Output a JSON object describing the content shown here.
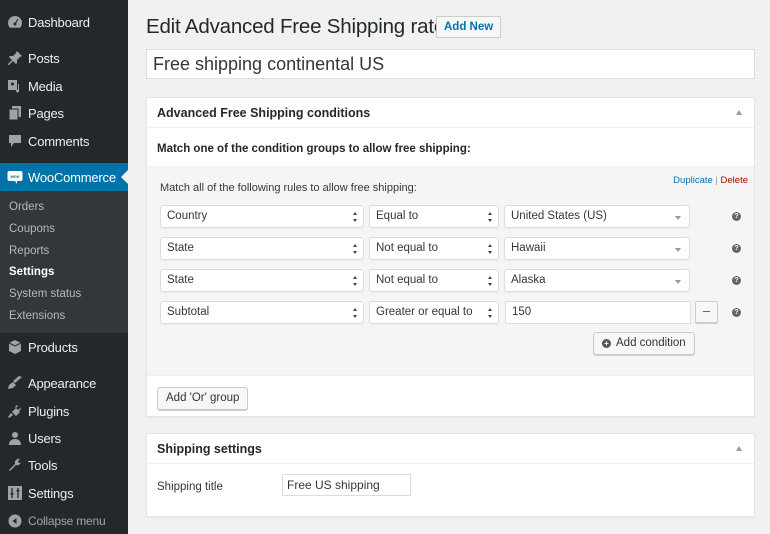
{
  "sidebar": {
    "items": [
      {
        "label": "Dashboard",
        "icon": "dashboard-icon"
      },
      {
        "label": "Posts",
        "icon": "pin-icon"
      },
      {
        "label": "Media",
        "icon": "media-icon"
      },
      {
        "label": "Pages",
        "icon": "pages-icon"
      },
      {
        "label": "Comments",
        "icon": "comment-icon"
      },
      {
        "label": "WooCommerce",
        "icon": "woo-icon",
        "active": true
      },
      {
        "label": "Products",
        "icon": "box-icon"
      },
      {
        "label": "Appearance",
        "icon": "brush-icon"
      },
      {
        "label": "Plugins",
        "icon": "plug-icon"
      },
      {
        "label": "Users",
        "icon": "user-icon"
      },
      {
        "label": "Tools",
        "icon": "wrench-icon"
      },
      {
        "label": "Settings",
        "icon": "sliders-icon"
      }
    ],
    "submenu": [
      {
        "label": "Orders"
      },
      {
        "label": "Coupons"
      },
      {
        "label": "Reports"
      },
      {
        "label": "Settings",
        "current": true
      },
      {
        "label": "System status"
      },
      {
        "label": "Extensions"
      }
    ],
    "collapse_label": "Collapse menu"
  },
  "header": {
    "title": "Edit Advanced Free Shipping rate",
    "add_new_label": "Add New"
  },
  "post_title": {
    "value": "Free shipping continental US"
  },
  "conditions_box": {
    "title": "Advanced Free Shipping conditions",
    "match_one_text": "Match one of the condition groups to allow free shipping:",
    "group": {
      "label": "Match all of the following rules to allow free shipping:",
      "duplicate_label": "Duplicate",
      "separator": "|",
      "delete_label": "Delete",
      "rules": [
        {
          "condition": "Country",
          "operator": "Equal to",
          "value": "United States (US)",
          "value_type": "select"
        },
        {
          "condition": "State",
          "operator": "Not equal to",
          "value": "Hawaii",
          "value_type": "select"
        },
        {
          "condition": "State",
          "operator": "Not equal to",
          "value": "Alaska",
          "value_type": "select"
        },
        {
          "condition": "Subtotal",
          "operator": "Greater or equal to",
          "value": "150",
          "value_type": "input"
        }
      ],
      "remove_label": "–",
      "help_glyph": "?",
      "add_condition_label": "Add condition",
      "add_condition_glyph": "+"
    },
    "add_or_group_label": "Add 'Or' group"
  },
  "shipping_box": {
    "title": "Shipping settings",
    "field_label": "Shipping title",
    "field_value": "Free US shipping"
  },
  "colors": {
    "sidebar_bg": "#23282d",
    "submenu_bg": "#32373c",
    "active_bg": "#0073aa",
    "link": "#0073aa",
    "delete": "#aa0000"
  }
}
